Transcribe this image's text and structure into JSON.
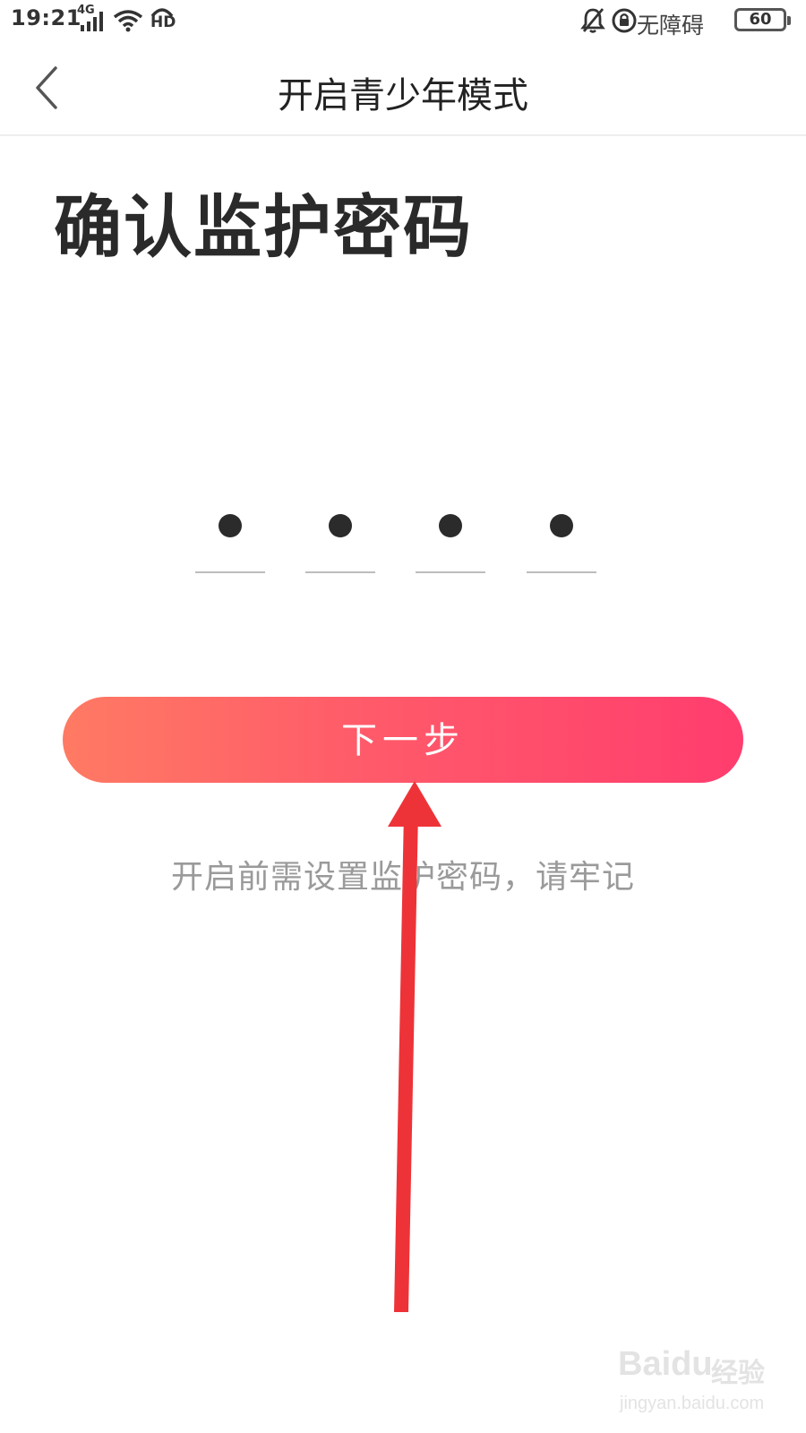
{
  "status_bar": {
    "time": "19:21",
    "network": "4G",
    "hd_badge": "HD",
    "accessibility_label": "无障碍",
    "battery": "60",
    "icons": [
      "signal-icon",
      "wifi-icon",
      "hd-call-icon",
      "alarm-off-icon",
      "rotation-lock-icon",
      "battery-icon"
    ]
  },
  "header": {
    "back_icon": "chevron-left-icon",
    "title": "开启青少年模式"
  },
  "page": {
    "heading": "确认监护密码"
  },
  "pin": {
    "digits_entered": 4,
    "digit_slots": 4,
    "mask_char": "●"
  },
  "actions": {
    "next_label": "下一步",
    "next_gradient": [
      "#ff7a63",
      "#ff3d6e"
    ]
  },
  "hint": "开启前需设置监护密码，请牢记",
  "annotation": {
    "type": "arrow",
    "color": "#ee3338",
    "points_to": "next-button"
  },
  "watermark": {
    "brand": "Baidu",
    "brand_cn": "经验",
    "url": "jingyan.baidu.com"
  }
}
